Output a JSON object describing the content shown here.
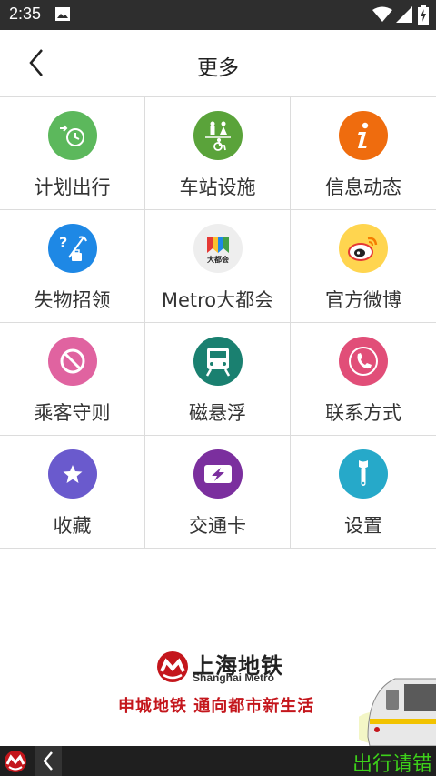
{
  "status_bar": {
    "time": "2:35",
    "icons": [
      "photo-icon",
      "wifi-icon",
      "signal-icon",
      "battery-icon"
    ]
  },
  "header": {
    "title": "更多",
    "back_icon": "chevron-left-icon"
  },
  "grid": {
    "items": [
      {
        "label": "计划出行",
        "icon": "plan-trip-icon",
        "color": "#5cb85c"
      },
      {
        "label": "车站设施",
        "icon": "station-facilities-icon",
        "color": "#5aa33a"
      },
      {
        "label": "信息动态",
        "icon": "info-icon",
        "color": "#ef6c0e"
      },
      {
        "label": "失物招领",
        "icon": "lost-found-icon",
        "color": "#1e88e5"
      },
      {
        "label": "Metro大都会",
        "icon": "metro-app-icon",
        "color": "#f0f0f0",
        "badge": "大都会"
      },
      {
        "label": "官方微博",
        "icon": "weibo-icon",
        "color": "#ffd54f"
      },
      {
        "label": "乘客守则",
        "icon": "rules-icon",
        "color": "#e063a0"
      },
      {
        "label": "磁悬浮",
        "icon": "maglev-icon",
        "color": "#1a8070"
      },
      {
        "label": "联系方式",
        "icon": "phone-icon",
        "color": "#e14e78"
      },
      {
        "label": "收藏",
        "icon": "favorite-star-icon",
        "color": "#6a5acd"
      },
      {
        "label": "交通卡",
        "icon": "transport-card-icon",
        "color": "#7b2f9e"
      },
      {
        "label": "设置",
        "icon": "wrench-icon",
        "color": "#26a9c9"
      }
    ]
  },
  "banner": {
    "brand_name": "上海地铁",
    "brand_en": "Shanghai Metro",
    "slogan": "申城地铁 通向都市新生活",
    "brand_color": "#c4161c"
  },
  "bottom_bar": {
    "ticker": "出行请错"
  }
}
